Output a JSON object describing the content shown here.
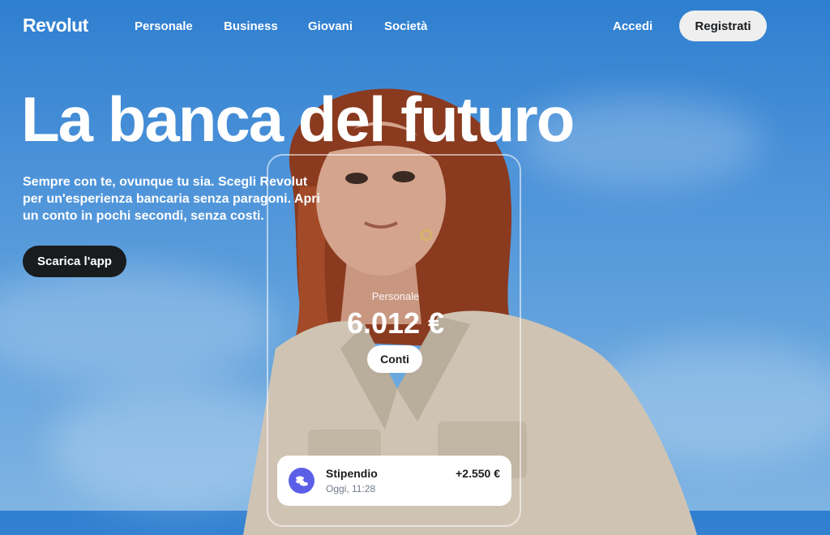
{
  "nav": {
    "logo": "Revolut",
    "links": [
      "Personale",
      "Business",
      "Giovani",
      "Società"
    ],
    "login": "Accedi",
    "signup": "Registrati"
  },
  "hero": {
    "headline": "La banca del futuro",
    "subtext": "Sempre con te, ovunque tu sia. Scegli Revolut per un'esperienza bancaria senza paragoni. Apri un conto in pochi secondi, senza costi.",
    "cta": "Scarica l'app"
  },
  "card": {
    "account_label": "Personale",
    "balance": "6.012 €",
    "accounts_button": "Conti",
    "transaction": {
      "title": "Stipendio",
      "time": "Oggi, 11:28",
      "amount": "+2.550 €",
      "icon": "coins-icon",
      "icon_color": "#5b5fe8"
    }
  },
  "colors": {
    "sky": "#4d93d9",
    "dark_button": "#191c1f",
    "light_button": "#efefef"
  }
}
